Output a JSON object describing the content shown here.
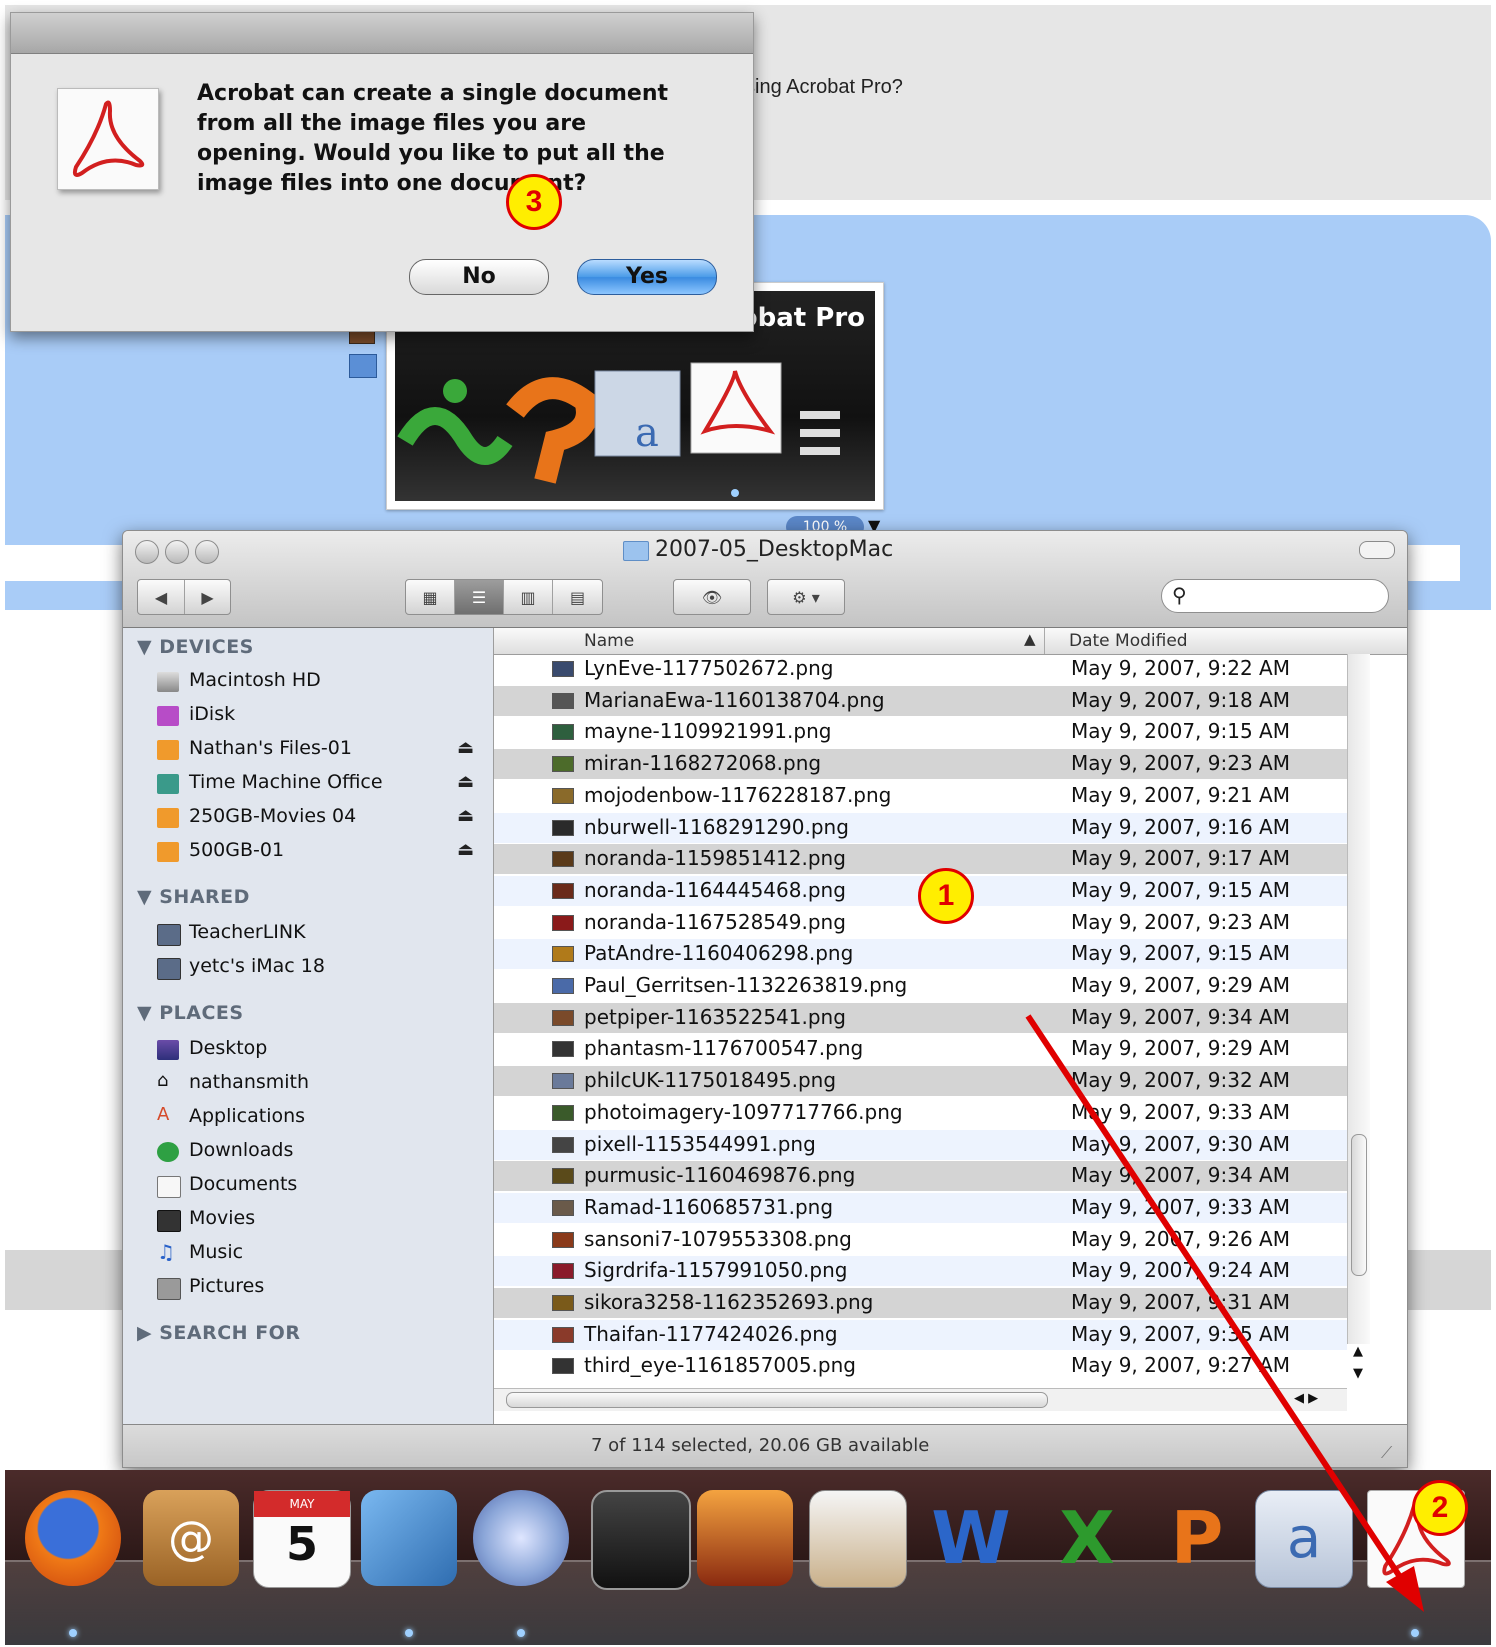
{
  "background": {
    "question_partial": "sing Acrobat Pro?",
    "preview_title_partial": "robat Pro",
    "zoom": "100 %"
  },
  "dialog": {
    "message": "Acrobat can create a single document from all the image files you are opening. Would you like to put all the image files into one document?",
    "no_label": "No",
    "yes_label": "Yes"
  },
  "finder": {
    "title": "2007-05_DesktopMac",
    "status": "7 of 114 selected, 20.06 GB available",
    "columns": {
      "name": "Name",
      "date": "Date Modified"
    },
    "sidebar": {
      "devices_header": "DEVICES",
      "devices": [
        {
          "label": "Macintosh HD",
          "icon": "hard-drive-icon",
          "eject": false
        },
        {
          "label": "iDisk",
          "icon": "idisk-icon",
          "eject": false
        },
        {
          "label": "Nathan's Files-01",
          "icon": "external-drive-icon",
          "eject": true
        },
        {
          "label": "Time Machine Office",
          "icon": "time-machine-drive-icon",
          "eject": true
        },
        {
          "label": "250GB-Movies 04",
          "icon": "external-drive-icon",
          "eject": true
        },
        {
          "label": "500GB-01",
          "icon": "external-drive-icon",
          "eject": true
        }
      ],
      "shared_header": "SHARED",
      "shared": [
        {
          "label": "TeacherLINK",
          "icon": "network-computer-icon"
        },
        {
          "label": "yetc's iMac 18",
          "icon": "network-computer-icon"
        }
      ],
      "places_header": "PLACES",
      "places": [
        {
          "label": "Desktop",
          "icon": "desktop-icon"
        },
        {
          "label": "nathansmith",
          "icon": "home-icon"
        },
        {
          "label": "Applications",
          "icon": "applications-icon"
        },
        {
          "label": "Downloads",
          "icon": "downloads-icon"
        },
        {
          "label": "Documents",
          "icon": "documents-icon"
        },
        {
          "label": "Movies",
          "icon": "movies-icon"
        },
        {
          "label": "Music",
          "icon": "music-icon"
        },
        {
          "label": "Pictures",
          "icon": "pictures-icon"
        }
      ],
      "search_header": "SEARCH FOR"
    },
    "files": [
      {
        "name": "LynEve-1177502672.png",
        "date": "May 9, 2007, 9:22 AM",
        "selected": false
      },
      {
        "name": "MarianaEwa-1160138704.png",
        "date": "May 9, 2007, 9:18 AM",
        "selected": true
      },
      {
        "name": "mayne-1109921991.png",
        "date": "May 9, 2007, 9:15 AM",
        "selected": false
      },
      {
        "name": "miran-1168272068.png",
        "date": "May 9, 2007, 9:23 AM",
        "selected": true
      },
      {
        "name": "mojodenbow-1176228187.png",
        "date": "May 9, 2007, 9:21 AM",
        "selected": false
      },
      {
        "name": "nburwell-1168291290.png",
        "date": "May 9, 2007, 9:16 AM",
        "selected": false
      },
      {
        "name": "noranda-1159851412.png",
        "date": "May 9, 2007, 9:17 AM",
        "selected": true
      },
      {
        "name": "noranda-1164445468.png",
        "date": "May 9, 2007, 9:15 AM",
        "selected": false
      },
      {
        "name": "noranda-1167528549.png",
        "date": "May 9, 2007, 9:23 AM",
        "selected": false
      },
      {
        "name": "PatAndre-1160406298.png",
        "date": "May 9, 2007, 9:15 AM",
        "selected": false
      },
      {
        "name": "Paul_Gerritsen-1132263819.png",
        "date": "May 9, 2007, 9:29 AM",
        "selected": false
      },
      {
        "name": "petpiper-1163522541.png",
        "date": "May 9, 2007, 9:34 AM",
        "selected": true
      },
      {
        "name": "phantasm-1176700547.png",
        "date": "May 9, 2007, 9:29 AM",
        "selected": false
      },
      {
        "name": "philcUK-1175018495.png",
        "date": "May 9, 2007, 9:32 AM",
        "selected": true
      },
      {
        "name": "photoimagery-1097717766.png",
        "date": "May 9, 2007, 9:33 AM",
        "selected": false
      },
      {
        "name": "pixell-1153544991.png",
        "date": "May 9, 2007, 9:30 AM",
        "selected": false
      },
      {
        "name": "purmusic-1160469876.png",
        "date": "May 9, 2007, 9:34 AM",
        "selected": true
      },
      {
        "name": "Ramad-1160685731.png",
        "date": "May 9, 2007, 9:33 AM",
        "selected": false
      },
      {
        "name": "sansoni7-1079553308.png",
        "date": "May 9, 2007, 9:26 AM",
        "selected": false
      },
      {
        "name": "Sigrdrifa-1157991050.png",
        "date": "May 9, 2007, 9:24 AM",
        "selected": false
      },
      {
        "name": "sikora3258-1162352693.png",
        "date": "May 9, 2007, 9:31 AM",
        "selected": true
      },
      {
        "name": "Thaifan-1177424026.png",
        "date": "May 9, 2007, 9:35 AM",
        "selected": false
      },
      {
        "name": "third_eye-1161857005.png",
        "date": "May 9, 2007, 9:27 AM",
        "selected": false
      }
    ]
  },
  "dock": {
    "apps": [
      "firefox-icon",
      "address-book-icon",
      "ical-icon",
      "iphoto-icon",
      "itunes-icon",
      "imovie-icon",
      "image-capture-icon",
      "iweb-icon",
      "word-icon",
      "excel-icon",
      "powerpoint-icon",
      "entourage-icon",
      "acrobat-icon"
    ],
    "ical_month": "MAY",
    "ical_day": "5"
  },
  "annotations": {
    "step1": "1",
    "step2": "2",
    "step3": "3"
  },
  "colors": {
    "annotation_red": "#e00000",
    "annotation_yellow": "#ffee00",
    "finder_selection": "#d4d4d4",
    "mac_blue_button": "#4a9be8"
  }
}
